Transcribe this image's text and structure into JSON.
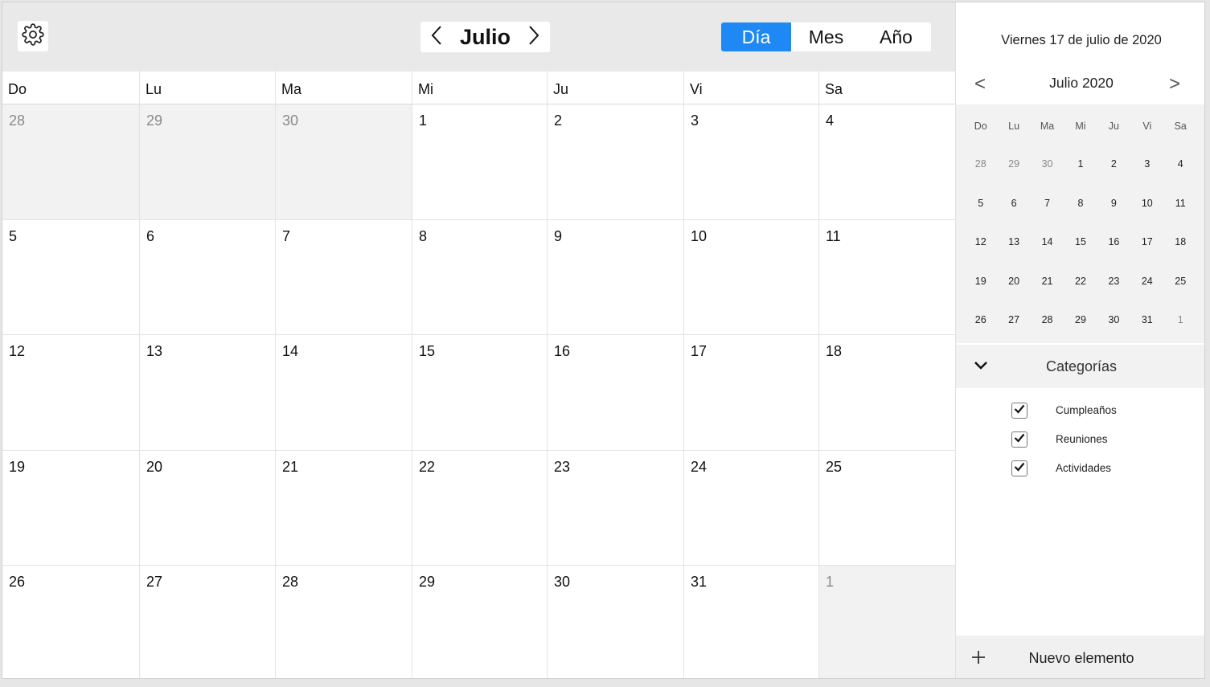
{
  "header": {
    "month_title": "Julio",
    "views": [
      {
        "label": "Día",
        "active": true
      },
      {
        "label": "Mes",
        "active": false
      },
      {
        "label": "Año",
        "active": false
      }
    ]
  },
  "month_grid": {
    "weekdays": [
      "Do",
      "Lu",
      "Ma",
      "Mi",
      "Ju",
      "Vi",
      "Sa"
    ],
    "weeks": [
      [
        {
          "d": "28",
          "other": true
        },
        {
          "d": "29",
          "other": true
        },
        {
          "d": "30",
          "other": true
        },
        {
          "d": "1"
        },
        {
          "d": "2"
        },
        {
          "d": "3"
        },
        {
          "d": "4"
        }
      ],
      [
        {
          "d": "5"
        },
        {
          "d": "6"
        },
        {
          "d": "7"
        },
        {
          "d": "8"
        },
        {
          "d": "9"
        },
        {
          "d": "10"
        },
        {
          "d": "11"
        }
      ],
      [
        {
          "d": "12"
        },
        {
          "d": "13"
        },
        {
          "d": "14"
        },
        {
          "d": "15"
        },
        {
          "d": "16"
        },
        {
          "d": "17"
        },
        {
          "d": "18"
        }
      ],
      [
        {
          "d": "19"
        },
        {
          "d": "20"
        },
        {
          "d": "21"
        },
        {
          "d": "22"
        },
        {
          "d": "23"
        },
        {
          "d": "24"
        },
        {
          "d": "25"
        }
      ],
      [
        {
          "d": "26"
        },
        {
          "d": "27"
        },
        {
          "d": "28"
        },
        {
          "d": "29"
        },
        {
          "d": "30"
        },
        {
          "d": "31"
        },
        {
          "d": "1",
          "other": true
        }
      ]
    ]
  },
  "sidebar": {
    "full_date": "Viernes 17 de julio de 2020",
    "mini_calendar": {
      "prev_label": "<",
      "next_label": ">",
      "title": "Julio 2020",
      "weekdays": [
        "Do",
        "Lu",
        "Ma",
        "Mi",
        "Ju",
        "Vi",
        "Sa"
      ],
      "weeks": [
        [
          {
            "d": "28",
            "other": true
          },
          {
            "d": "29",
            "other": true
          },
          {
            "d": "30",
            "other": true
          },
          {
            "d": "1"
          },
          {
            "d": "2"
          },
          {
            "d": "3"
          },
          {
            "d": "4"
          }
        ],
        [
          {
            "d": "5"
          },
          {
            "d": "6"
          },
          {
            "d": "7"
          },
          {
            "d": "8"
          },
          {
            "d": "9"
          },
          {
            "d": "10"
          },
          {
            "d": "11"
          }
        ],
        [
          {
            "d": "12"
          },
          {
            "d": "13"
          },
          {
            "d": "14"
          },
          {
            "d": "15"
          },
          {
            "d": "16"
          },
          {
            "d": "17"
          },
          {
            "d": "18"
          }
        ],
        [
          {
            "d": "19"
          },
          {
            "d": "20"
          },
          {
            "d": "21"
          },
          {
            "d": "22"
          },
          {
            "d": "23"
          },
          {
            "d": "24"
          },
          {
            "d": "25"
          }
        ],
        [
          {
            "d": "26"
          },
          {
            "d": "27"
          },
          {
            "d": "28"
          },
          {
            "d": "29"
          },
          {
            "d": "30"
          },
          {
            "d": "31"
          },
          {
            "d": "1",
            "other": true
          }
        ]
      ]
    },
    "categories": {
      "title": "Categorías",
      "items": [
        {
          "label": "Cumpleaños",
          "checked": true
        },
        {
          "label": "Reuniones",
          "checked": true
        },
        {
          "label": "Actividades",
          "checked": true
        }
      ]
    },
    "new_item_label": "Nuevo elemento"
  },
  "icons": {
    "settings": "gear-icon",
    "prev_month": "chevron-left-icon",
    "next_month": "chevron-right-icon",
    "collapse": "chevron-down-icon",
    "add": "plus-icon",
    "check": "check-icon"
  },
  "colors": {
    "accent": "#1e88f5",
    "other_month_bg": "#f2f2f2",
    "topbar_bg": "#e9e9e9"
  }
}
